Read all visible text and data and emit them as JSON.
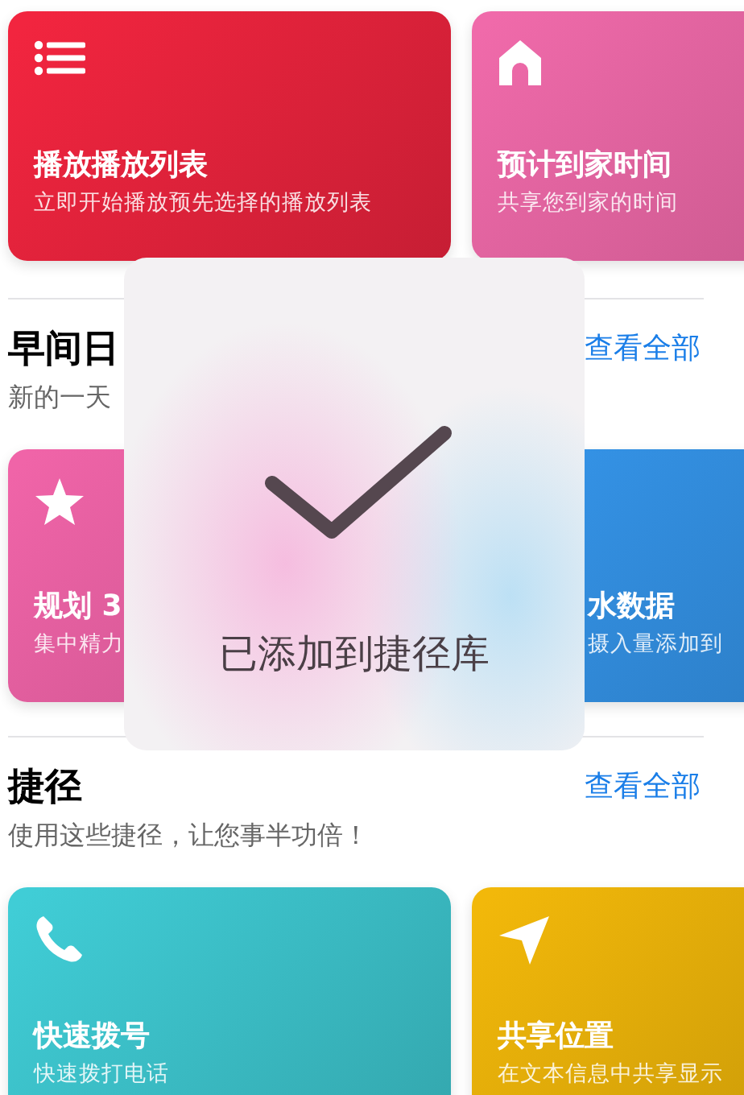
{
  "sections": [
    {
      "cards": [
        {
          "title": "播放播放列表",
          "subtitle": "立即开始播放预先选择的播放列表",
          "kind": "list",
          "color": "#f2253f"
        },
        {
          "title": "预计到家时间",
          "subtitle": "共享您到家的时间",
          "kind": "house",
          "color": "#f06aaa"
        }
      ]
    },
    {
      "title": "早间日",
      "subtitle": "新的一天",
      "link": "查看全部",
      "cards": [
        {
          "title": "规划 3",
          "subtitle": "集中精力",
          "kind": "star",
          "color": "#f064a8"
        },
        {
          "title": "水数据",
          "subtitle": "摄入量添加到",
          "color": "#3595ea"
        }
      ]
    },
    {
      "title": "捷径",
      "subtitle": "使用这些捷径，让您事半功倍！",
      "link": "查看全部",
      "cards": [
        {
          "title": "快速拨号",
          "subtitle": "快速拨打电话",
          "kind": "phone",
          "color": "#40cdd6"
        },
        {
          "title": "共享位置",
          "subtitle": "在文本信息中共享显示",
          "kind": "arrow",
          "color": "#f2b80a"
        }
      ]
    }
  ],
  "toast": {
    "message": "已添加到捷径库"
  }
}
